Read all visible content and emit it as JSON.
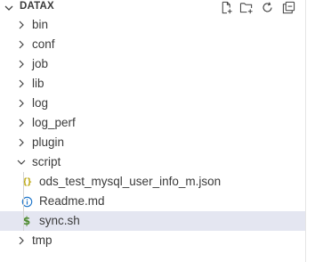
{
  "explorer": {
    "title": "DATAX",
    "actions": [
      {
        "name": "new-file-icon"
      },
      {
        "name": "new-folder-icon"
      },
      {
        "name": "refresh-icon"
      },
      {
        "name": "collapse-all-icon"
      }
    ],
    "folders_top": [
      "bin",
      "conf",
      "job",
      "lib",
      "log",
      "log_perf",
      "plugin"
    ],
    "script_folder": "script",
    "script_files": [
      {
        "label": "ods_test_mysql_user_info_m.json",
        "icon": "json-icon"
      },
      {
        "label": "Readme.md",
        "icon": "info-icon"
      },
      {
        "label": "sync.sh",
        "icon": "dollar-icon"
      }
    ],
    "folders_bottom": [
      "tmp"
    ]
  },
  "colors": {
    "selected_row": "#e4e6f1",
    "json_icon": "#b8a100",
    "info_icon": "#1a73c9",
    "shell_icon": "#4d8a2e"
  }
}
